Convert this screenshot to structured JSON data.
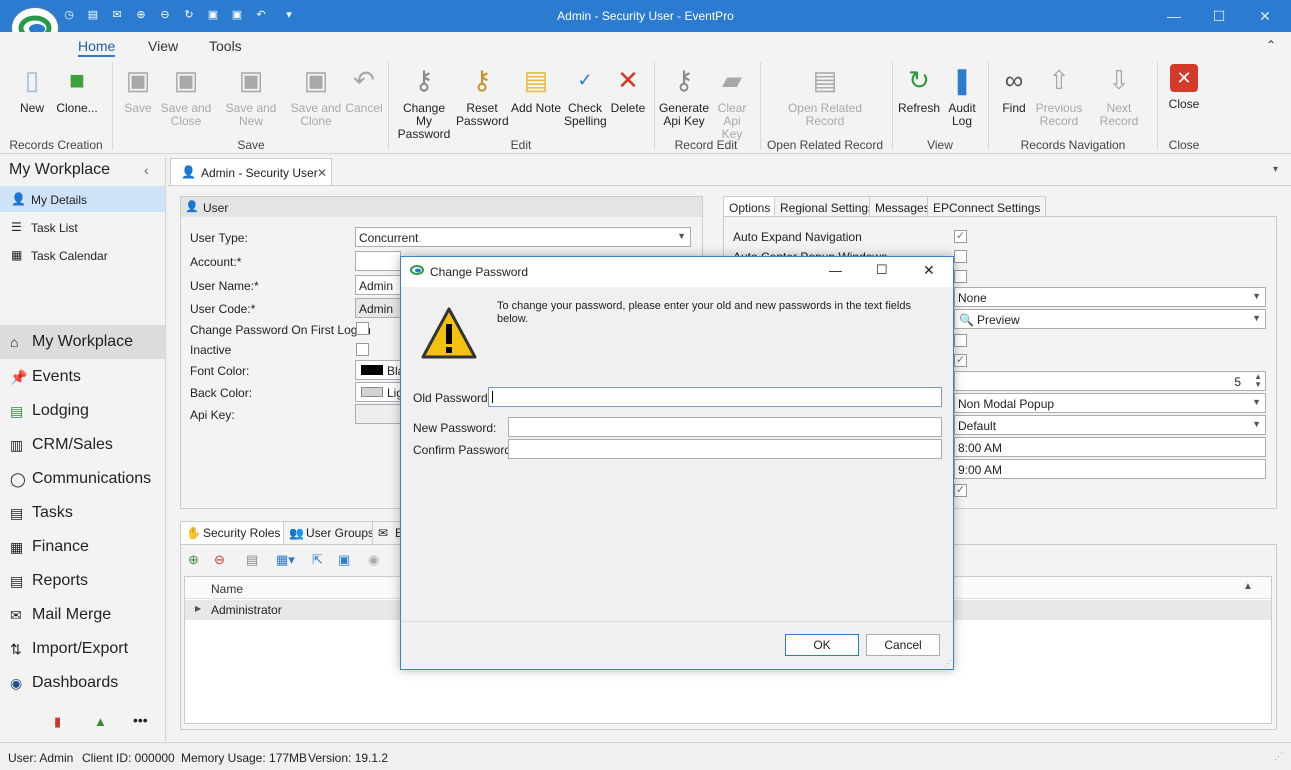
{
  "window": {
    "title": "Admin - Security User - EventPro"
  },
  "ribbon": {
    "tabs": [
      "Home",
      "View",
      "Tools"
    ],
    "buttons": {
      "new": "New",
      "clone": "Clone...",
      "save": "Save",
      "save_close": "Save and Close",
      "save_new": "Save and New",
      "save_clone": "Save and Clone",
      "cancel": "Cancel",
      "change_pw": "Change My Password",
      "reset_pw": "Reset Password",
      "add_note": "Add Note",
      "check_spelling": "Check Spelling",
      "delete": "Delete",
      "gen_api": "Generate Api Key",
      "clear_api": "Clear Api Key",
      "open_related": "Open Related Record",
      "refresh": "Refresh",
      "audit": "Audit Log",
      "find": "Find",
      "prev": "Previous Record",
      "next": "Next Record",
      "close": "Close"
    },
    "groups": {
      "records_creation": "Records Creation",
      "save": "Save",
      "edit": "Edit",
      "record_edit": "Record Edit",
      "open_related": "Open Related Record",
      "view": "View",
      "records_nav": "Records Navigation",
      "close": "Close"
    }
  },
  "sidebar": {
    "header": "My Workplace",
    "top_items": [
      "My Details",
      "Task List",
      "Task Calendar"
    ],
    "nav_items": [
      "My Workplace",
      "Events",
      "Lodging",
      "CRM/Sales",
      "Communications",
      "Tasks",
      "Finance",
      "Reports",
      "Mail Merge",
      "Import/Export",
      "Dashboards"
    ],
    "more": "•••"
  },
  "doc_tab": {
    "label": "Admin - Security User"
  },
  "user_panel": {
    "title": "User",
    "labels": [
      "User Type:",
      "Account:*",
      "User Name:*",
      "User Code:*",
      "Change Password On First Logon",
      "Inactive",
      "Font Color:",
      "Back Color:",
      "Api Key:"
    ],
    "user_type": "Concurrent",
    "user_name": "Admin",
    "user_code": "Admin",
    "font_color": "Bla",
    "back_color": "Lig"
  },
  "options_panel": {
    "tabs": [
      "Options",
      "Regional Settings",
      "Messages",
      "EPConnect Settings"
    ],
    "labels": [
      "Auto Expand Navigation",
      "Auto Center Popup Windows"
    ],
    "values": {
      "none": "None",
      "preview": "Preview",
      "number": "5",
      "popup": "Non Modal Popup",
      "default": "Default",
      "time1": "8:00 AM",
      "time2": "9:00 AM"
    }
  },
  "bottom_tabs": [
    "Security Roles",
    "User Groups",
    "E"
  ],
  "grid": {
    "column": "Name",
    "rows": [
      "Administrator"
    ]
  },
  "dialog": {
    "title": "Change Password",
    "message": "To change your password, please enter your old and new passwords in the text fields below.",
    "old_label": "Old Password:",
    "new_label": "New Password:",
    "confirm_label": "Confirm Password:",
    "ok": "OK",
    "cancel": "Cancel"
  },
  "status": {
    "user": "User: Admin",
    "client": "Client ID: 000000",
    "memory": "Memory Usage: 177MB",
    "version": "Version: 19.1.2"
  }
}
